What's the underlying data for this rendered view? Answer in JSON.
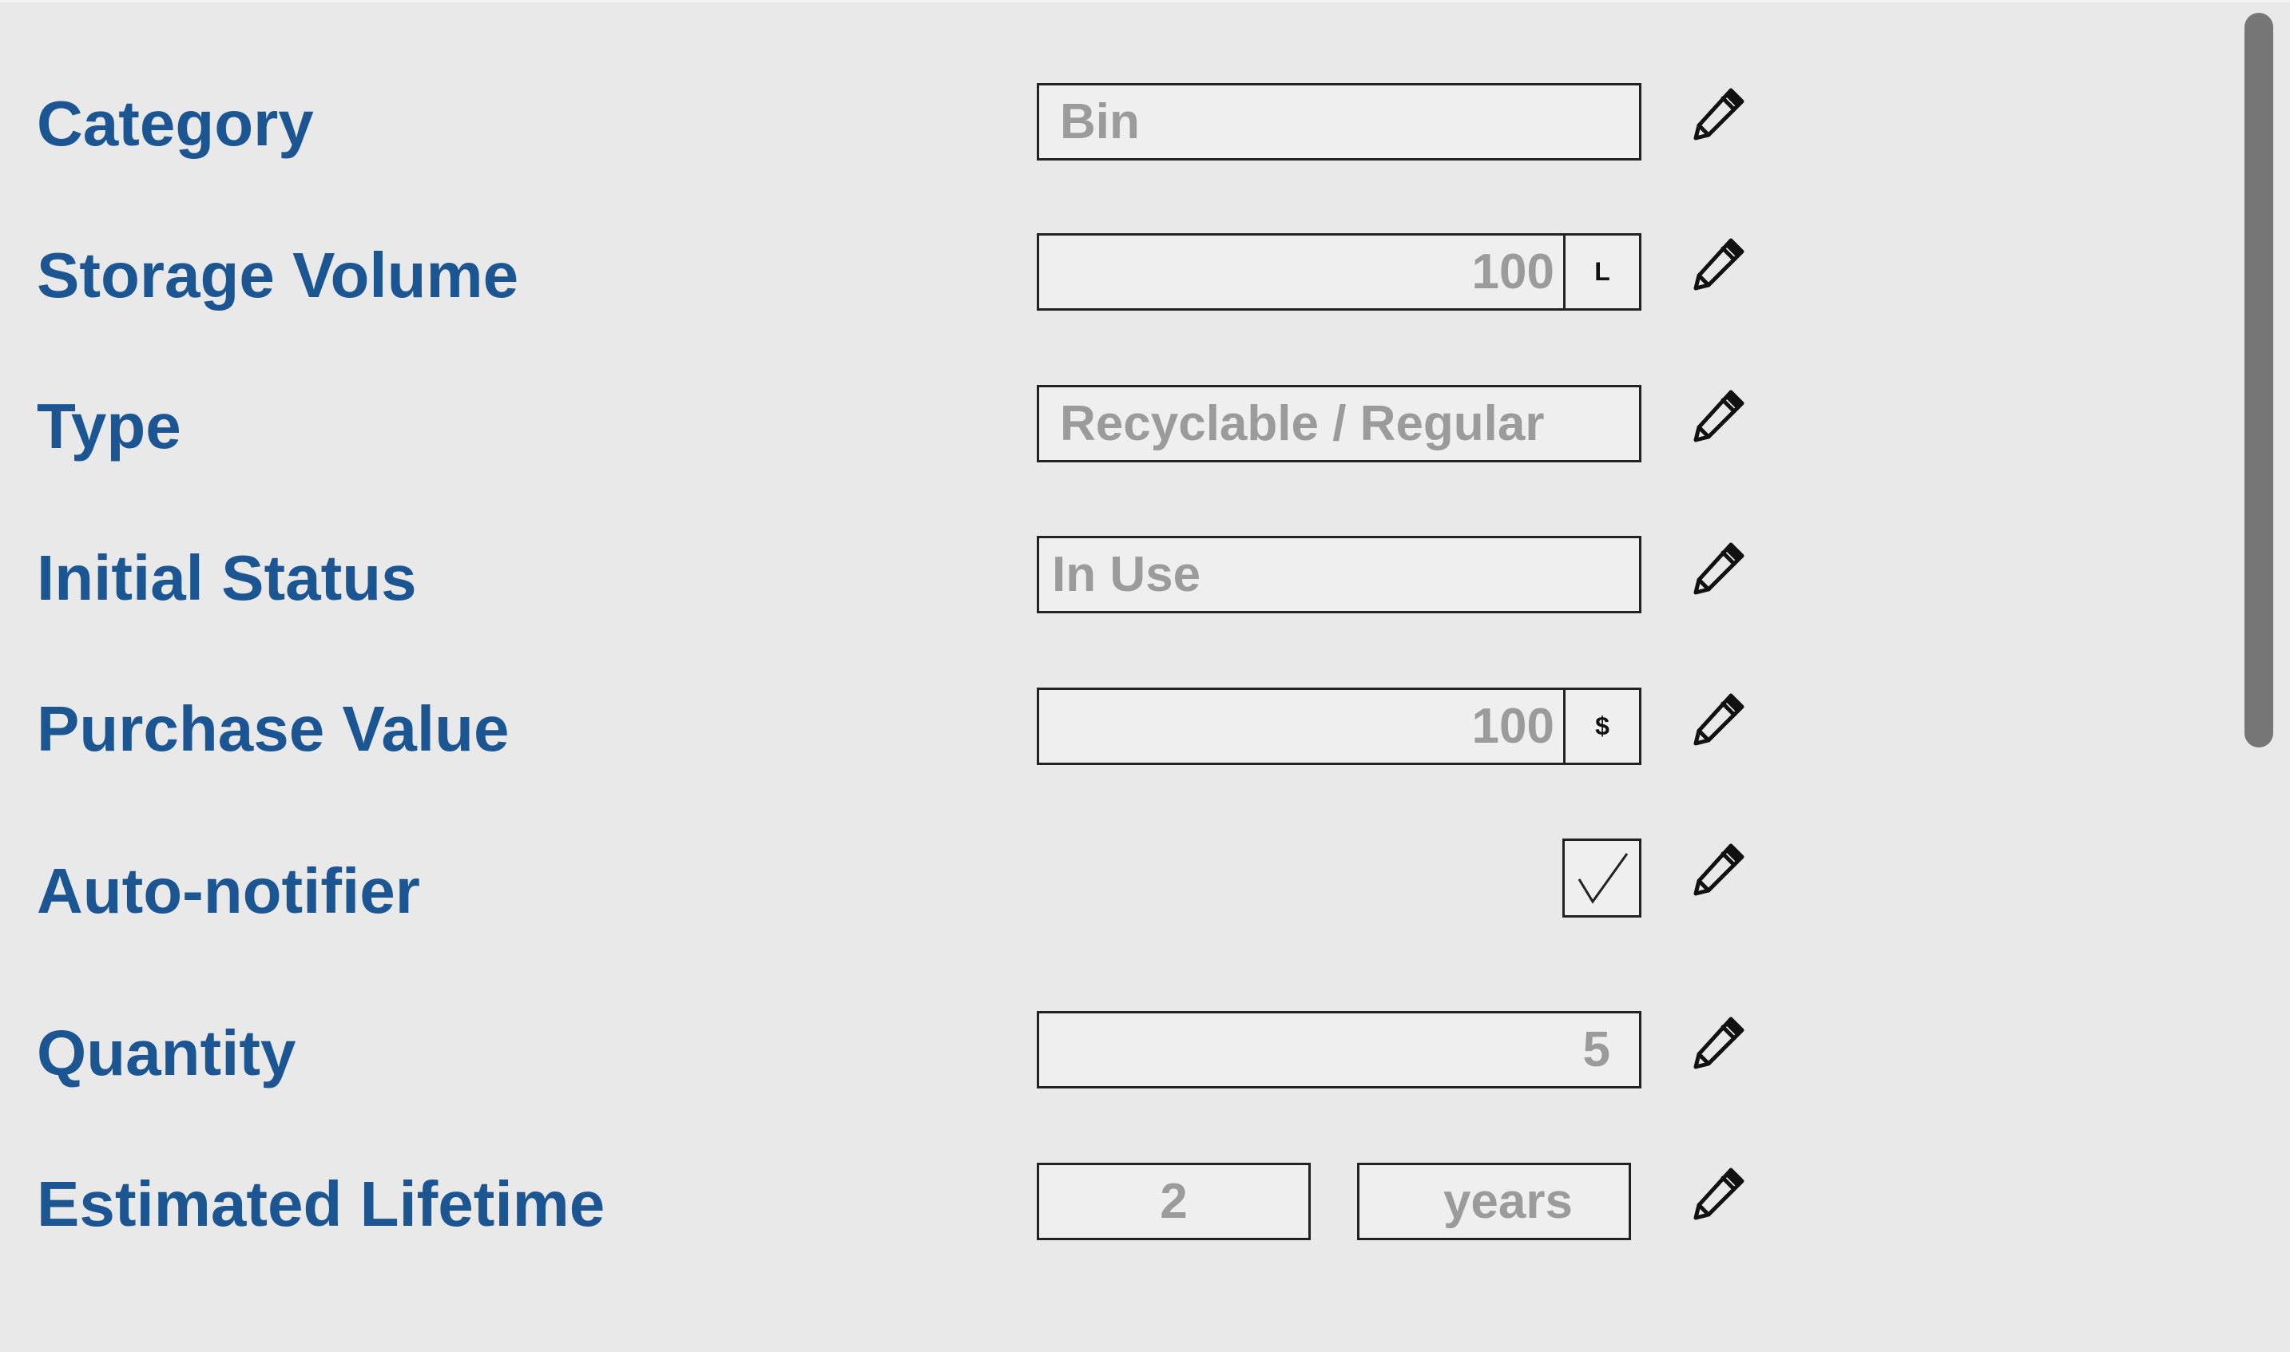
{
  "form": {
    "rows": {
      "category": {
        "label": "Category",
        "value": "Bin"
      },
      "storage_volume": {
        "label": "Storage Volume",
        "value": "100",
        "unit": "L"
      },
      "type": {
        "label": "Type",
        "value": "Recyclable / Regular"
      },
      "initial_status": {
        "label": "Initial Status",
        "value": "In Use"
      },
      "purchase_value": {
        "label": "Purchase Value",
        "value": "100",
        "unit": "$"
      },
      "auto_notifier": {
        "label": "Auto-notifier",
        "checked": true
      },
      "quantity": {
        "label": "Quantity",
        "value": "5"
      },
      "estimated_lifetime": {
        "label": "Estimated Lifetime",
        "value": "2",
        "unit": "years"
      }
    },
    "edit_icon": "pencil-icon",
    "colors": {
      "label": "#1b5592",
      "value_text": "#9b9b9b",
      "background": "#e9e9e9",
      "field_background": "#f0efef",
      "scrollbar": "#767676"
    }
  }
}
